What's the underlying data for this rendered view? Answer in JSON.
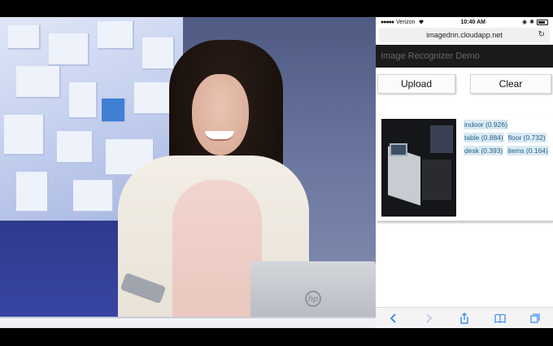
{
  "statusbar": {
    "carrier": "Verizon",
    "time": "10:40 AM"
  },
  "browser": {
    "url": "imagednn.cloudapp.net"
  },
  "app": {
    "title": "Image Recognizer Demo",
    "upload_label": "Upload",
    "clear_label": "Clear"
  },
  "results": {
    "tags": [
      [
        "indoor (0.926)"
      ],
      [
        "table (0.884)",
        "floor (0.732)"
      ],
      [
        "desk (0.393)",
        "items (0.164)"
      ]
    ]
  },
  "laptop_logo": "hp",
  "colors": {
    "tag_bg": "#dbeaf4",
    "tag_text": "#1c5f88",
    "appbar_bg": "#1b1b1b",
    "safari_blue": "#1e7cf2"
  },
  "icons": [
    "wifi-icon",
    "reload-icon",
    "back-icon",
    "forward-icon",
    "share-icon",
    "bookmarks-icon",
    "tabs-icon"
  ]
}
